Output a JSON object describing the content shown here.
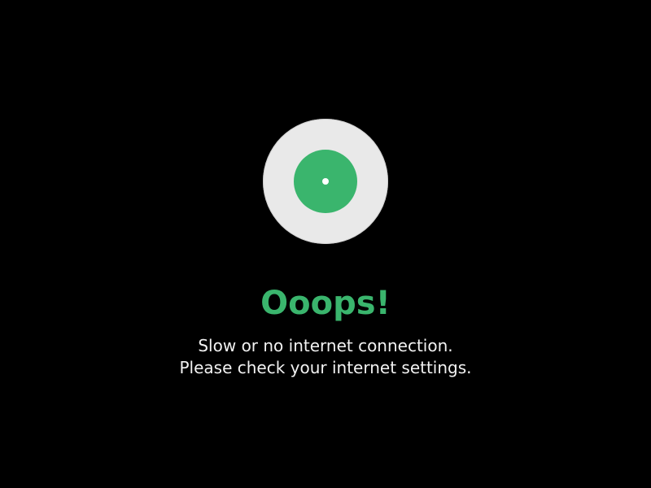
{
  "error": {
    "icon": "vinyl-disc-icon",
    "title": "Ooops!",
    "message_line1": "Slow or no internet connection.",
    "message_line2": "Please check your internet settings."
  },
  "colors": {
    "background": "#000000",
    "accent": "#3ab56d",
    "disc": "#e9e9e9",
    "text": "#f2f2f2"
  }
}
